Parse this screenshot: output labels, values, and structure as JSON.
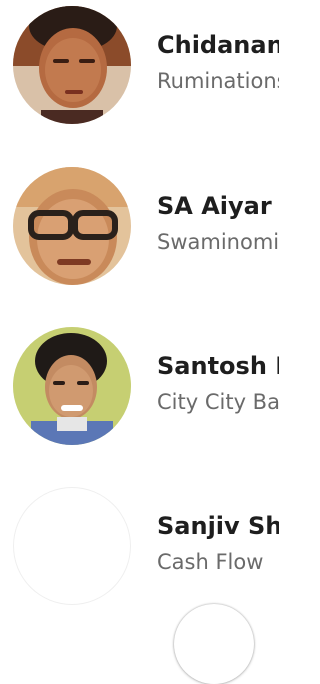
{
  "authors": [
    {
      "name": "Chidanand Rajghatta",
      "column": "Ruminations"
    },
    {
      "name": "SA Aiyar",
      "column": "Swaminomics"
    },
    {
      "name": "Santosh Desai",
      "column": "City City Bang Bang"
    },
    {
      "name": "Sanjiv Shankaran",
      "column": "Cash Flow"
    }
  ],
  "avatars": [
    {
      "icon": "author-photo-1",
      "bg": "#8a5a36"
    },
    {
      "icon": "author-photo-2",
      "bg": "#e2b98a"
    },
    {
      "icon": "author-photo-3",
      "bg": "#c9d36a"
    },
    {
      "icon": "avatar-placeholder",
      "bg": "#ffffff"
    }
  ]
}
